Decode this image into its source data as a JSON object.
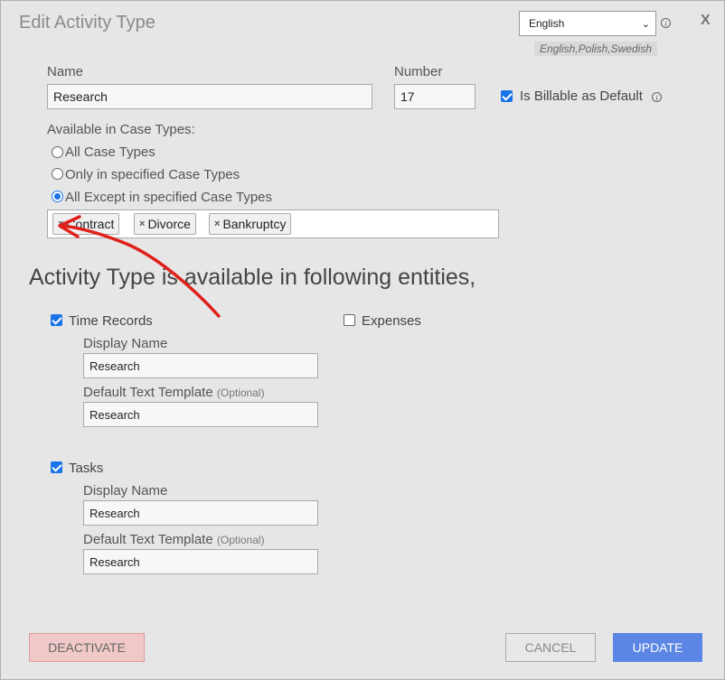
{
  "dialog": {
    "title": "Edit Activity Type",
    "close_label": "X"
  },
  "language": {
    "selected": "English",
    "available_hint": "English,Polish,Swedish"
  },
  "form": {
    "name_label": "Name",
    "name_value": "Research",
    "number_label": "Number",
    "number_value": "17",
    "billable_label": "Is Billable as Default",
    "billable_checked": true,
    "case_types_label": "Available in Case Types:",
    "case_type_options": [
      {
        "label": "All Case Types",
        "selected": false
      },
      {
        "label": "Only in specified Case Types",
        "selected": false
      },
      {
        "label": "All Except in specified Case Types",
        "selected": true
      }
    ],
    "case_type_tags": [
      "Contract",
      "Divorce",
      "Bankruptcy"
    ]
  },
  "entities": {
    "heading": "Activity Type is available in following entities,",
    "time_records": {
      "label": "Time Records",
      "checked": true,
      "display_name_label": "Display Name",
      "display_name_value": "Research",
      "template_label": "Default Text Template",
      "optional_label": "(Optional)",
      "template_value": "Research"
    },
    "expenses": {
      "label": "Expenses",
      "checked": false
    },
    "tasks": {
      "label": "Tasks",
      "checked": true,
      "display_name_label": "Display Name",
      "display_name_value": "Research",
      "template_label": "Default Text Template",
      "optional_label": "(Optional)",
      "template_value": "Research"
    }
  },
  "buttons": {
    "deactivate": "DEACTIVATE",
    "cancel": "CANCEL",
    "update": "UPDATE"
  },
  "colors": {
    "accent": "#1a73e8",
    "update_button": "#5b86e5",
    "deactivate_button": "#f0c8c8",
    "annotation_arrow": "#e0201a"
  },
  "icons": {
    "info": "info-icon",
    "tag_remove": "close-icon",
    "dropdown": "chevron-down-icon"
  }
}
